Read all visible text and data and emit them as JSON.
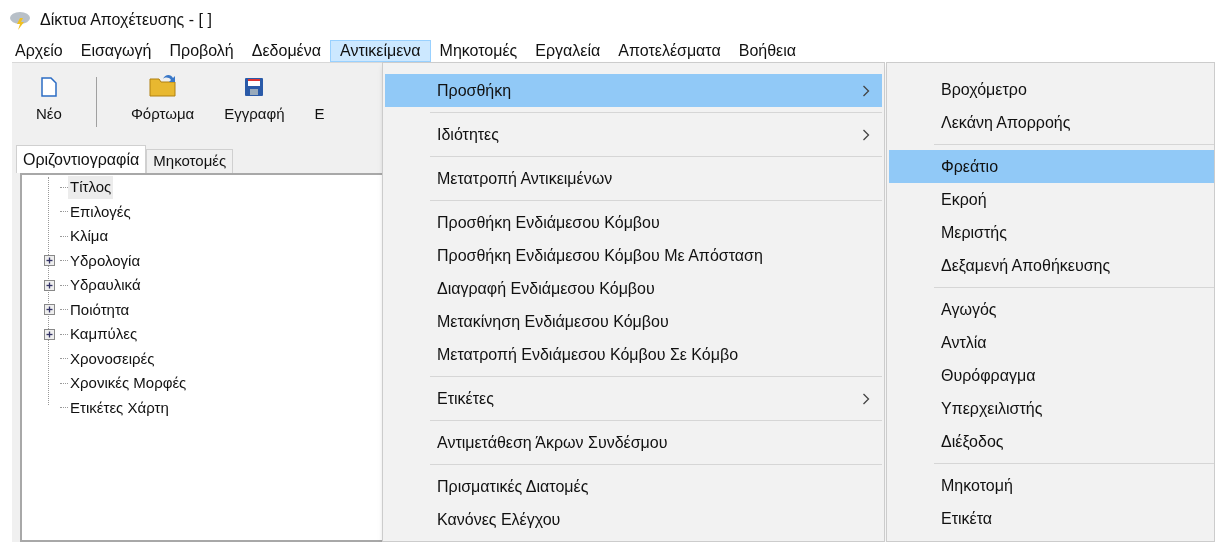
{
  "window": {
    "title": "Δίκτυα Αποχέτευσης - [ ]"
  },
  "menu_bar": [
    {
      "label": "Αρχείο",
      "selected": false
    },
    {
      "label": "Εισαγωγή",
      "selected": false
    },
    {
      "label": "Προβολή",
      "selected": false
    },
    {
      "label": "Δεδομένα",
      "selected": false
    },
    {
      "label": "Αντικείμενα",
      "selected": true
    },
    {
      "label": "Μηκοτομές",
      "selected": false
    },
    {
      "label": "Εργαλεία",
      "selected": false
    },
    {
      "label": "Αποτελέσματα",
      "selected": false
    },
    {
      "label": "Βοήθεια",
      "selected": false
    }
  ],
  "toolbar": [
    {
      "label": "Νέο",
      "kind": "new"
    },
    {
      "kind": "separator"
    },
    {
      "label": "Φόρτωμα",
      "kind": "open"
    },
    {
      "label": "Εγγραφή",
      "kind": "save"
    },
    {
      "label": "Ε",
      "kind": "hidden"
    }
  ],
  "tabs": [
    {
      "label": "Οριζοντιογραφία",
      "selected": true
    },
    {
      "label": "Μηκοτομές",
      "selected": false
    }
  ],
  "tree": [
    {
      "label": "Τίτλος",
      "selected": true
    },
    {
      "label": "Επιλογές",
      "selected": false
    },
    {
      "label": "Κλίμα",
      "selected": false
    },
    {
      "label": "Υδρολογία",
      "selected": false,
      "expanded": false
    },
    {
      "label": "Υδραυλικά",
      "selected": false,
      "expanded": false
    },
    {
      "label": "Ποιότητα",
      "selected": false,
      "expanded": false
    },
    {
      "label": "Καμπύλες",
      "selected": false,
      "expanded": false
    },
    {
      "label": "Χρονοσειρές",
      "selected": false
    },
    {
      "label": "Χρονικές Μορφές",
      "selected": false
    },
    {
      "label": "Ετικέτες Χάρτη",
      "selected": false
    }
  ],
  "menu": {
    "sections": [
      {
        "items": [
          {
            "label": "Προσθήκη",
            "submenu": true,
            "selected": true
          }
        ]
      },
      {
        "items": [
          {
            "label": "Ιδιότητες",
            "submenu": true,
            "selected": false
          }
        ]
      },
      {
        "items": [
          {
            "label": "Μετατροπή Αντικειμένων",
            "submenu": false,
            "selected": false
          }
        ]
      },
      {
        "items": [
          {
            "label": "Προσθήκη Ενδιάμεσου Κόμβου",
            "submenu": false,
            "selected": false
          },
          {
            "label": "Προσθήκη Ενδιάμεσου Κόμβου Με Απόσταση",
            "submenu": false,
            "selected": false
          },
          {
            "label": "Διαγραφή Ενδιάμεσου Κόμβου",
            "submenu": false,
            "selected": false
          },
          {
            "label": "Μετακίνηση Ενδιάμεσου Κόμβου",
            "submenu": false,
            "selected": false
          },
          {
            "label": "Μετατροπή Ενδιάμεσου Κόμβου Σε Κόμβο",
            "submenu": false,
            "selected": false
          }
        ]
      },
      {
        "items": [
          {
            "label": "Ετικέτες",
            "submenu": true,
            "selected": false
          }
        ]
      },
      {
        "items": [
          {
            "label": "Αντιμετάθεση Άκρων Συνδέσμου",
            "submenu": false,
            "selected": false
          }
        ]
      },
      {
        "items": [
          {
            "label": "Πρισματικές Διατομές",
            "submenu": false,
            "selected": false
          },
          {
            "label": "Κανόνες Ελέγχου",
            "submenu": false,
            "selected": false
          }
        ]
      }
    ]
  },
  "submenu": {
    "sections": [
      {
        "items": [
          {
            "label": "Βροχόμετρο",
            "selected": false
          },
          {
            "label": "Λεκάνη Απορροής",
            "selected": false
          }
        ]
      },
      {
        "items": [
          {
            "label": "Φρεάτιο",
            "selected": true
          },
          {
            "label": "Εκροή",
            "selected": false
          },
          {
            "label": "Μεριστής",
            "selected": false
          },
          {
            "label": "Δεξαμενή Αποθήκευσης",
            "selected": false
          }
        ]
      },
      {
        "items": [
          {
            "label": "Αγωγός",
            "selected": false
          },
          {
            "label": "Αντλία",
            "selected": false
          },
          {
            "label": "Θυρόφραγμα",
            "selected": false
          },
          {
            "label": "Υπερχειλιστής",
            "selected": false
          },
          {
            "label": "Διέξοδος",
            "selected": false
          }
        ]
      },
      {
        "items": [
          {
            "label": "Μηκοτομή",
            "selected": false
          },
          {
            "label": "Ετικέτα",
            "selected": false
          }
        ]
      }
    ]
  }
}
